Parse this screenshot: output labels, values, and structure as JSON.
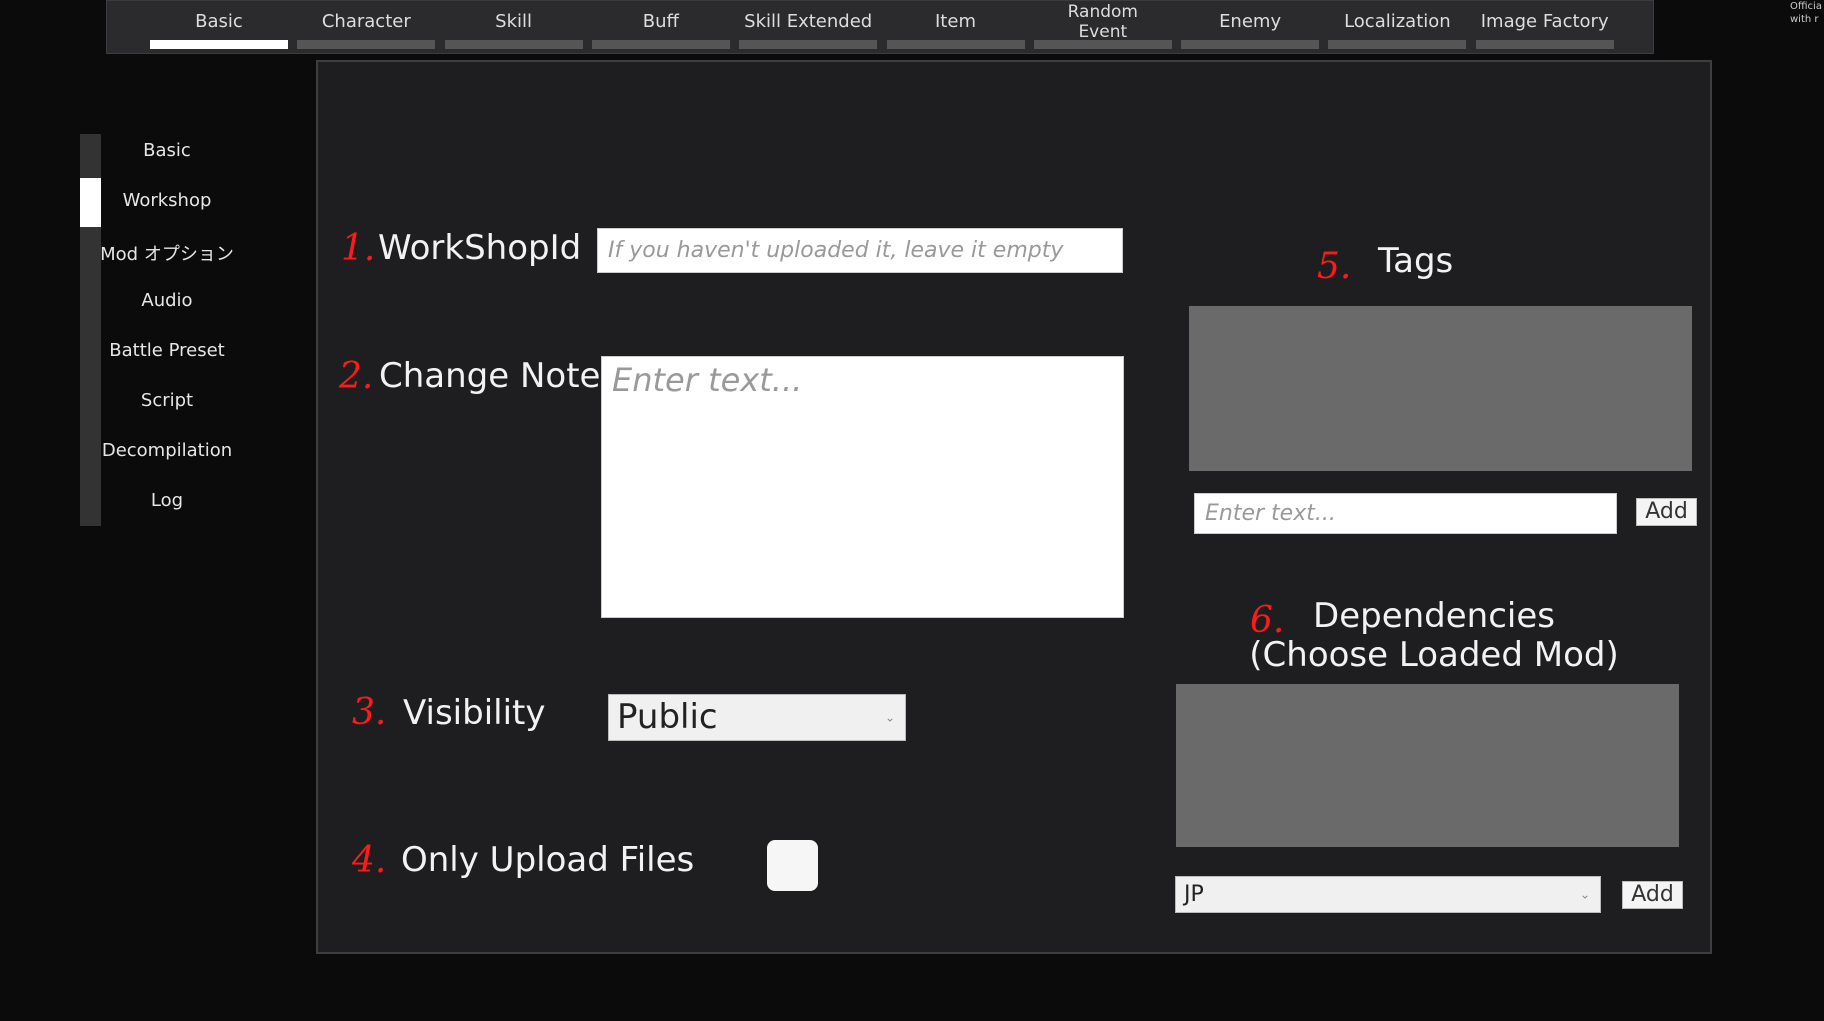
{
  "tabs": [
    {
      "label": "Basic",
      "active": true
    },
    {
      "label": "Character"
    },
    {
      "label": "Skill"
    },
    {
      "label": "Buff"
    },
    {
      "label": "Skill Extended"
    },
    {
      "label": "Item"
    },
    {
      "label": "Random Event"
    },
    {
      "label": "Enemy"
    },
    {
      "label": "Localization"
    },
    {
      "label": "Image Factory"
    }
  ],
  "sidebar": {
    "items": [
      "Basic",
      "Workshop",
      "Mod オプション",
      "Audio",
      "Battle Preset",
      "Script",
      "Decompilation",
      "Log"
    ],
    "active": "Workshop"
  },
  "corner_text": [
    "Officia",
    "with r"
  ],
  "form": {
    "workshop_id": {
      "num": "1.",
      "label": "WorkShopId",
      "placeholder": "If you haven't uploaded it, leave it empty",
      "value": ""
    },
    "change_note": {
      "num": "2.",
      "label": "Change Note",
      "placeholder": "Enter text...",
      "value": ""
    },
    "visibility": {
      "num": "3.",
      "label": "Visibility",
      "value": "Public"
    },
    "only_upload": {
      "num": "4.",
      "label": "Only Upload Files",
      "checked": false
    },
    "tags": {
      "num": "5.",
      "label": "Tags",
      "placeholder": "Enter text...",
      "add": "Add"
    },
    "dependencies": {
      "num": "6.",
      "label_line1": "Dependencies",
      "label_line2": "(Choose Loaded Mod)",
      "value": "JP",
      "add": "Add"
    }
  },
  "colors": {
    "annotation": "#ff1a1a",
    "panel": "#1e1e20",
    "active_indicator": "#ffffff"
  }
}
